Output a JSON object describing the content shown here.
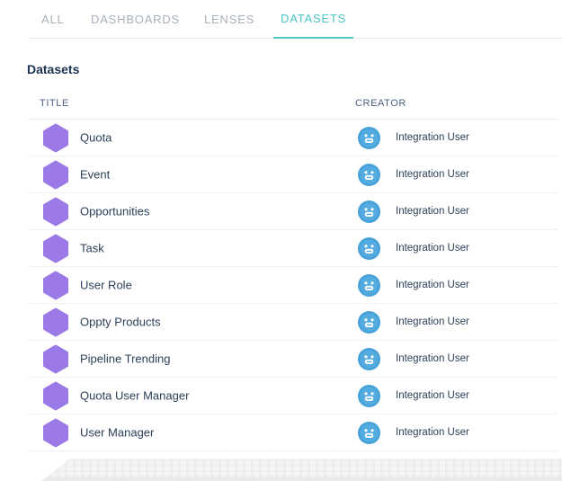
{
  "tabs": [
    {
      "label": "ALL",
      "active": false
    },
    {
      "label": "DASHBOARDS",
      "active": false
    },
    {
      "label": "LENSES",
      "active": false
    },
    {
      "label": "DATASETS",
      "active": true
    }
  ],
  "section": {
    "heading": "Datasets"
  },
  "table": {
    "headers": {
      "title": "TITLE",
      "creator": "CREATOR"
    },
    "rows": [
      {
        "title": "Quota",
        "creator": "Integration User"
      },
      {
        "title": "Event",
        "creator": "Integration User"
      },
      {
        "title": "Opportunities",
        "creator": "Integration User"
      },
      {
        "title": "Task",
        "creator": "Integration User"
      },
      {
        "title": "User Role",
        "creator": "Integration User"
      },
      {
        "title": "Oppty Products",
        "creator": "Integration User"
      },
      {
        "title": "Pipeline Trending",
        "creator": "Integration User"
      },
      {
        "title": "Quota User Manager",
        "creator": "Integration User"
      },
      {
        "title": "User Manager",
        "creator": "Integration User"
      }
    ]
  },
  "icons": {
    "dataset_icon": "hexagon-icon",
    "creator_icon": "smiley-avatar-icon"
  },
  "colors": {
    "accent_teal": "#4dc6c6",
    "dataset_purple": "#9b79e7",
    "avatar_blue_dark": "#46a1d9",
    "avatar_blue": "#54abdf",
    "heading_text": "#1a3353",
    "row_text": "#2c4059",
    "inactive_tab": "#a8b0ba",
    "column_header_text": "#4a607e"
  }
}
